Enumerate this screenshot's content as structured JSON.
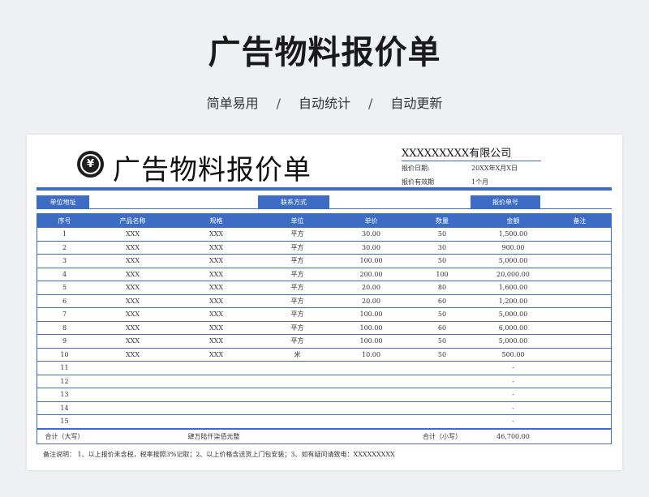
{
  "page": {
    "title": "广告物料报价单",
    "subtitle": [
      "简单易用",
      "自动统计",
      "自动更新"
    ],
    "subtitle_separator": "/"
  },
  "sheet": {
    "logo_symbol": "¥",
    "title": "广告物料报价单",
    "company": "XXXXXXXXX有限公司",
    "quote_date_label": "报价日期:",
    "quote_date_value": "20XX年X月X日",
    "validity_label": "报价有效期",
    "validity_value": "1个月",
    "info": {
      "address_label": "单位地址",
      "contact_label": "联系方式",
      "quote_no_label": "报价单号"
    },
    "columns": [
      "序号",
      "产品名称",
      "规格",
      "单位",
      "单价",
      "数量",
      "金额",
      "备注"
    ],
    "rows": [
      [
        "1",
        "XXX",
        "XXX",
        "平方",
        "30.00",
        "50",
        "1,500.00",
        ""
      ],
      [
        "2",
        "XXX",
        "XXX",
        "平方",
        "30.00",
        "30",
        "900.00",
        ""
      ],
      [
        "3",
        "XXX",
        "XXX",
        "平方",
        "100.00",
        "50",
        "5,000.00",
        ""
      ],
      [
        "4",
        "XXX",
        "XXX",
        "平方",
        "200.00",
        "100",
        "20,000.00",
        ""
      ],
      [
        "5",
        "XXX",
        "XXX",
        "平方",
        "20.00",
        "80",
        "1,600.00",
        ""
      ],
      [
        "6",
        "XXX",
        "XXX",
        "平方",
        "20.00",
        "60",
        "1,200.00",
        ""
      ],
      [
        "7",
        "XXX",
        "XXX",
        "平方",
        "100.00",
        "50",
        "5,000.00",
        ""
      ],
      [
        "8",
        "XXX",
        "XXX",
        "平方",
        "100.00",
        "60",
        "6,000.00",
        ""
      ],
      [
        "9",
        "XXX",
        "XXX",
        "平方",
        "100.00",
        "50",
        "5,000.00",
        ""
      ],
      [
        "10",
        "XXX",
        "XXX",
        "米",
        "10.00",
        "50",
        "500.00",
        ""
      ],
      [
        "11",
        "",
        "",
        "",
        "",
        "",
        "-",
        ""
      ],
      [
        "12",
        "",
        "",
        "",
        "",
        "",
        "-",
        ""
      ],
      [
        "13",
        "",
        "",
        "",
        "",
        "",
        "-",
        ""
      ],
      [
        "14",
        "",
        "",
        "",
        "",
        "",
        "-",
        ""
      ],
      [
        "15",
        "",
        "",
        "",
        "",
        "",
        "-",
        ""
      ]
    ],
    "total": {
      "upper_label": "合计（大写）",
      "upper_value": "肆万陆仟柒佰元整",
      "lower_label": "合计（小写）",
      "lower_value": "46,700.00"
    },
    "notes": "备注说明：  1、以上报价未含税，税率按照3%记取；2、以上价格含送货上门包安装；3、如有疑问请致电：XXXXXXXXX"
  },
  "colors": {
    "accent": "#3d6cc4",
    "background": "#eef0f3"
  }
}
